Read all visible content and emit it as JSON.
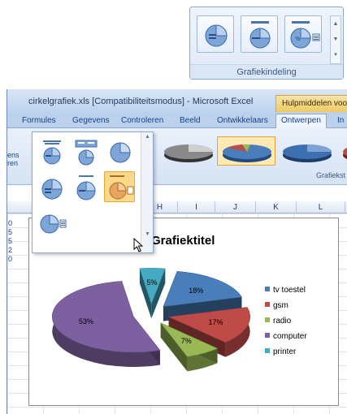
{
  "zoom_panel": {
    "group_label": "Grafiekindeling",
    "tiles": [
      {
        "icon": "layout-1-icon"
      },
      {
        "icon": "layout-2-icon"
      },
      {
        "icon": "layout-3-icon"
      }
    ]
  },
  "window": {
    "title": "cirkelgrafiek.xls  [Compatibiliteitsmodus] - Microsoft Excel",
    "tools_tab": "Hulpmiddelen voor g"
  },
  "ribbon": {
    "tabs": [
      "Formules",
      "Gegevens",
      "Controleren",
      "Beeld",
      "Ontwikkelaars",
      "Ontwerpen",
      "In"
    ],
    "active_tab": "Ontwerpen",
    "left_fragment": [
      "ens",
      "ren"
    ],
    "styles_group_label": "Grafiekst"
  },
  "sheet": {
    "column_headers": [
      "H",
      "I",
      "J",
      "K",
      "L"
    ],
    "cell_fragments": [
      "0",
      "5",
      "5",
      "2",
      "0"
    ]
  },
  "colors": {
    "tv_toestel": "#4a7ebb",
    "gsm": "#be4b48",
    "radio": "#98b954",
    "computer": "#7d60a0",
    "printer": "#46aac5"
  },
  "chart_data": {
    "type": "pie",
    "title": "Grafiektitel",
    "categories": [
      "tv toestel",
      "gsm",
      "radio",
      "computer",
      "printer"
    ],
    "values": [
      18,
      17,
      7,
      53,
      5
    ],
    "data_labels": [
      "18%",
      "17%",
      "7%",
      "53%",
      "5%"
    ],
    "legend": "right",
    "exploded": true,
    "style": "3d"
  }
}
